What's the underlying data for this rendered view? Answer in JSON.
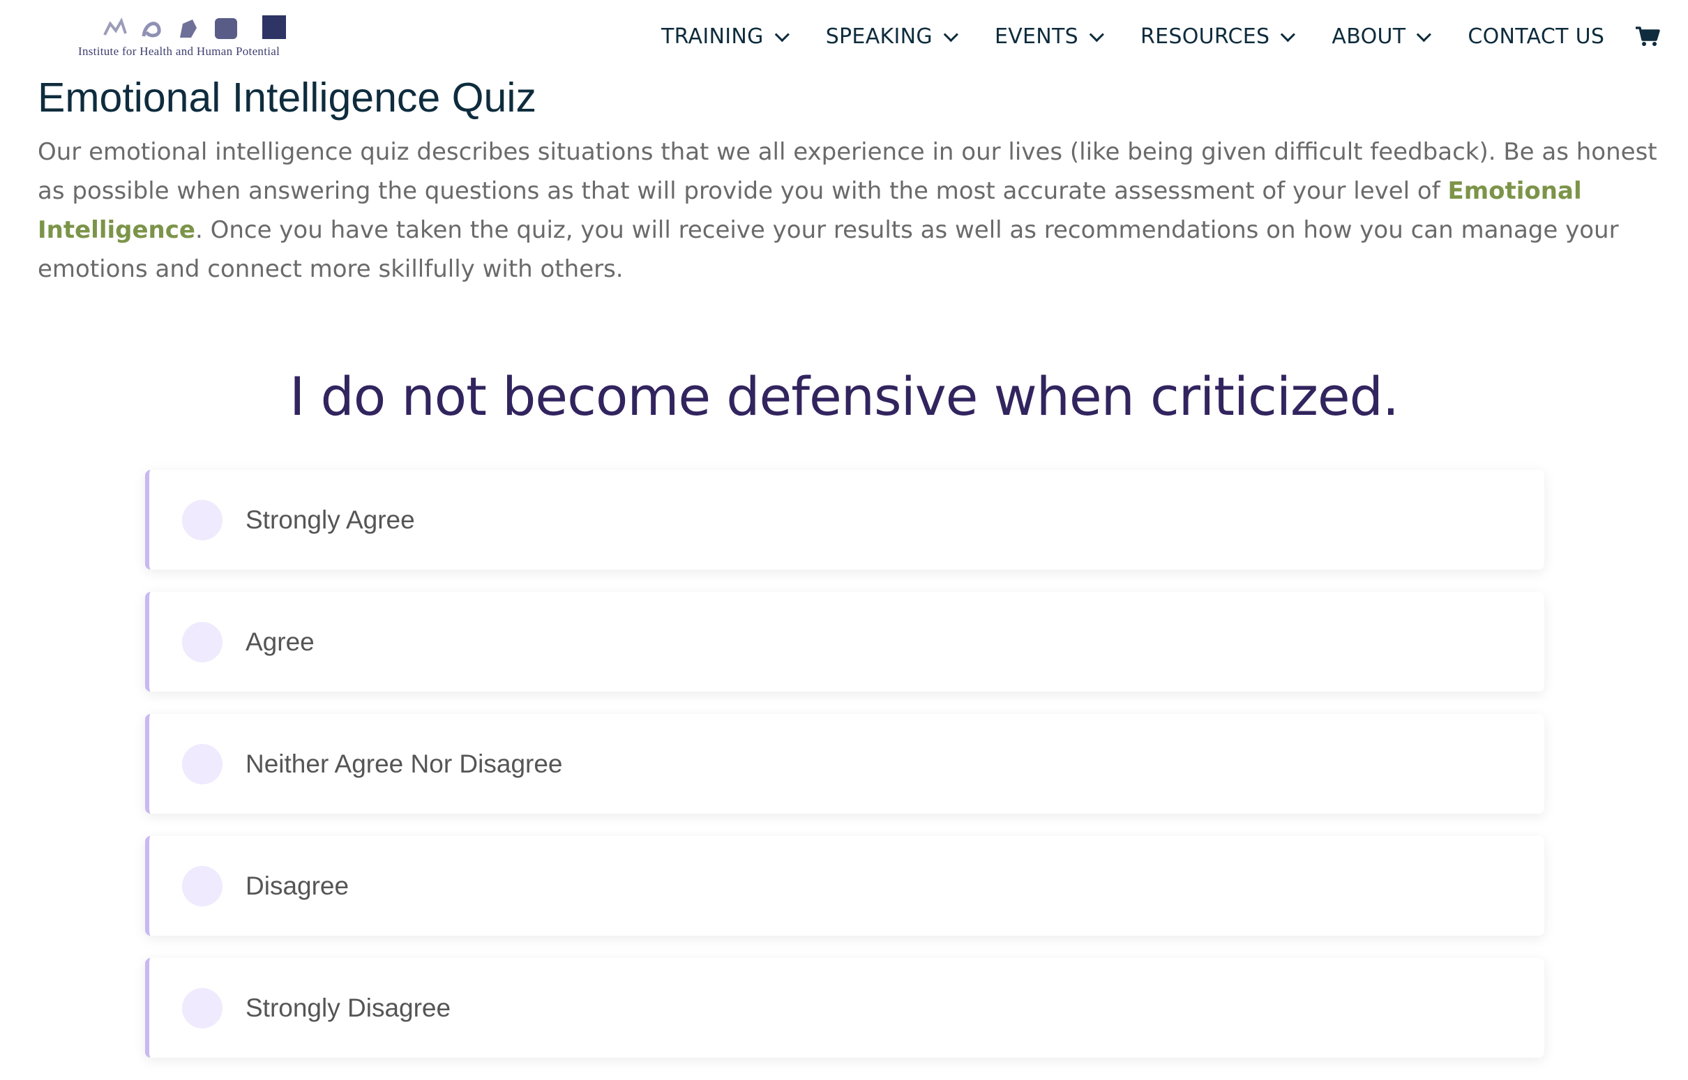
{
  "header": {
    "logo_text": "Institute for Health and Human Potential",
    "nav": [
      {
        "label": "TRAINING",
        "has_dropdown": true
      },
      {
        "label": "SPEAKING",
        "has_dropdown": true
      },
      {
        "label": "EVENTS",
        "has_dropdown": true
      },
      {
        "label": "RESOURCES",
        "has_dropdown": true
      },
      {
        "label": "ABOUT",
        "has_dropdown": true
      },
      {
        "label": "CONTACT US",
        "has_dropdown": false
      }
    ],
    "cart_icon": "shopping-cart-icon"
  },
  "page": {
    "title": "Emotional Intelligence Quiz",
    "intro_before_link": "Our emotional intelligence quiz describes situations that we all experience in our lives (like being given difficult feedback). Be as honest as possible when answering the questions as that will provide you with the most accurate assessment of your level of ",
    "intro_link": "Emotional Intelligence",
    "intro_after_link": ". Once you have taken the quiz, you will receive your results as well as recommendations on how you can manage your emotions and connect more skillfully with others."
  },
  "quiz": {
    "question": "I do not become defensive when criticized.",
    "options": [
      {
        "label": "Strongly Agree"
      },
      {
        "label": "Agree"
      },
      {
        "label": "Neither Agree Nor Disagree"
      },
      {
        "label": "Disagree"
      },
      {
        "label": "Strongly Disagree"
      }
    ]
  },
  "colors": {
    "heading": "#0e2c3d",
    "question": "#32245e",
    "link": "#7c9449",
    "option_accent": "#c9b8f1",
    "radio_fill": "#efeafd",
    "logo": "#3d3f6e"
  }
}
